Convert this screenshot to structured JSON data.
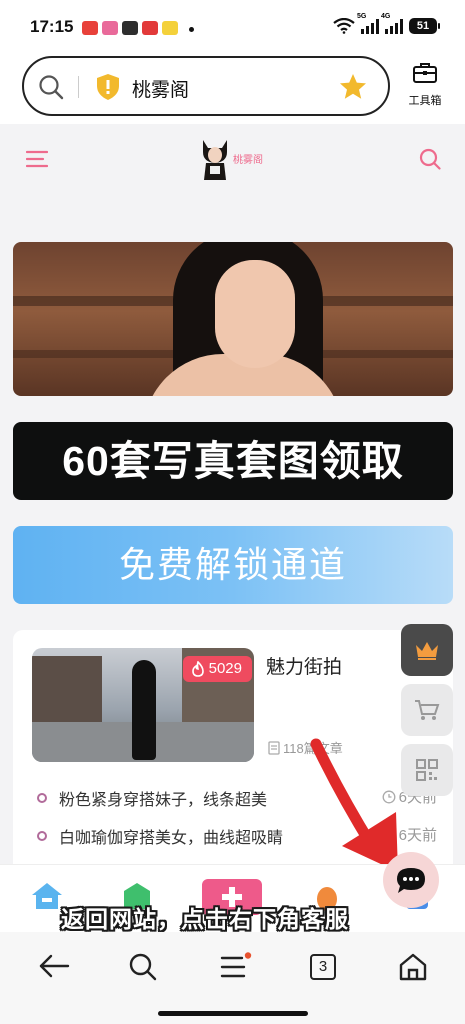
{
  "status_bar": {
    "time": "17:15",
    "battery": "51",
    "network_1": "5G",
    "network_2": "4G"
  },
  "browser": {
    "site_name": "桃雾阁",
    "toolbox_label": "工具箱",
    "tab_count": "3"
  },
  "site": {
    "logo_text": "桃雾阁",
    "banner_dark_text": "60套写真套图领取",
    "banner_blue_text": "免费解锁通道"
  },
  "card": {
    "hot_count": "5029",
    "title": "魅力街拍",
    "meta": "118篇文章",
    "posts": [
      {
        "title": "粉色紧身穿搭妹子，线条超美",
        "age": "6天前"
      },
      {
        "title": "白咖瑜伽穿搭美女，曲线超吸睛",
        "age": "6天前"
      }
    ]
  },
  "overlay": {
    "text": "返回网站，点击右下角客服"
  },
  "colors": {
    "accent_pink": "#ee6b8d",
    "hot_red": "#ef4b5f",
    "banner_blue": "#5fb2f2",
    "star_yellow": "#f2b92d"
  }
}
